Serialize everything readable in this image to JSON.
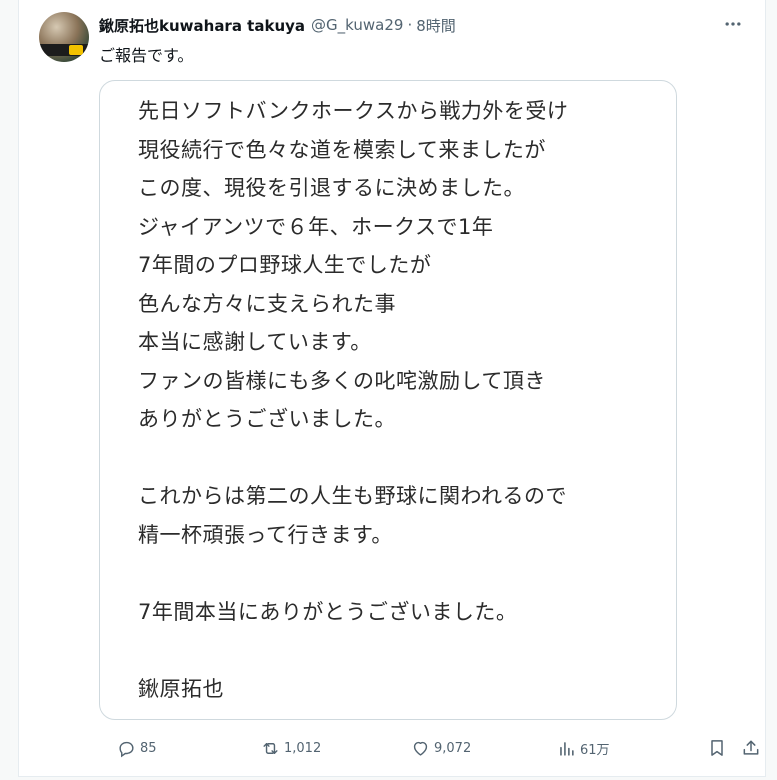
{
  "post": {
    "author_name": "鍬原拓也kuwahara takuya",
    "handle": "@G_kuwa29",
    "separator": "·",
    "time": "8時間",
    "text": "ご報告です。",
    "more_icon": "more-horizontal-icon",
    "image_lines": [
      "先日ソフトバンクホークスから戦力外を受け",
      "現役続行で色々な道を模索して来ましたが",
      "この度、現役を引退するに決めました。",
      "ジャイアンツで６年、ホークスで1年",
      "7年間のプロ野球人生でしたが",
      "色んな方々に支えられた事",
      "本当に感謝しています。",
      "ファンの皆様にも多くの叱咤激励して頂き",
      "ありがとうございました。",
      "",
      "これからは第二の人生も野球に関われるので",
      "精一杯頑張って行きます。",
      "",
      "7年間本当にありがとうございました。",
      "",
      "鍬原拓也"
    ]
  },
  "actions": {
    "reply_count": "85",
    "repost_count": "1,012",
    "like_count": "9,072",
    "views_count": "61万"
  },
  "colors": {
    "text_primary": "#0f1419",
    "text_secondary": "#536471",
    "border": "#cfd9de"
  }
}
